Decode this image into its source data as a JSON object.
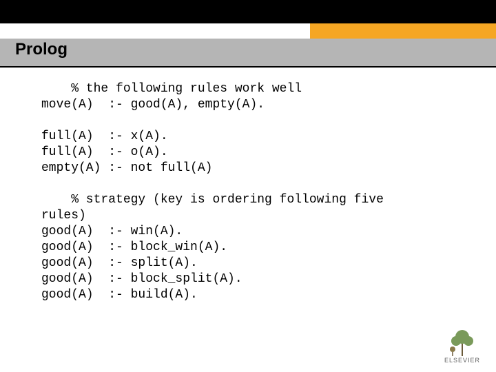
{
  "slide": {
    "title": "Prolog",
    "code": "    % the following rules work well\nmove(A)  :- good(A), empty(A).\n\nfull(A)  :- x(A).\nfull(A)  :- o(A).\nempty(A) :- not full(A)\n\n    % strategy (key is ordering following five\nrules)\ngood(A)  :- win(A).\ngood(A)  :- block_win(A).\ngood(A)  :- split(A).\ngood(A)  :- block_split(A).\ngood(A)  :- build(A).",
    "publisher": "ELSEVIER"
  }
}
